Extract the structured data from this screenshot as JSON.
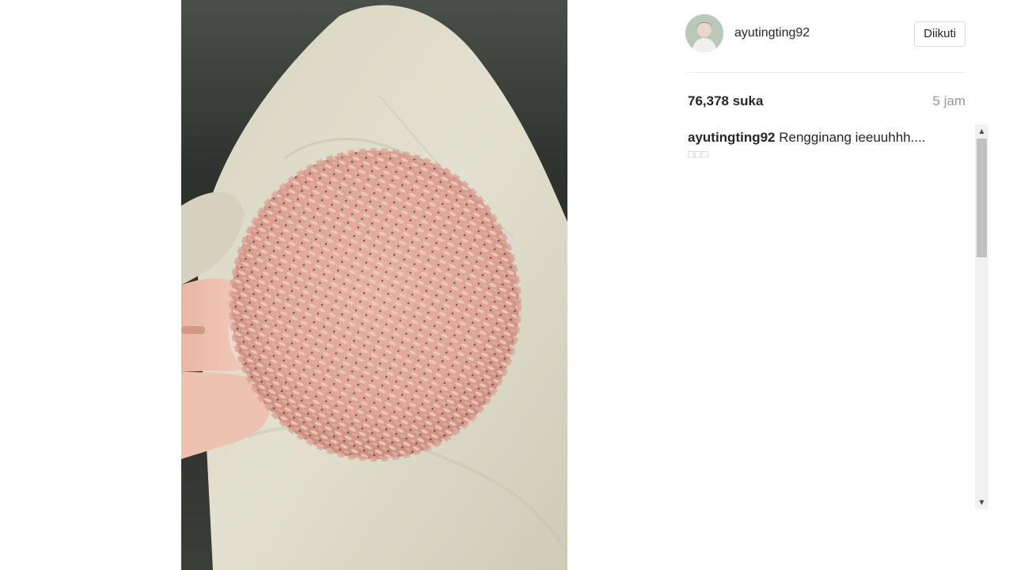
{
  "post": {
    "image_alt": "Hand holding a round pink rice cracker (rengginang) over a beige cloth",
    "likes": "76,378 suka",
    "time": "5 jam"
  },
  "author": {
    "username": "ayutingting92",
    "follow_label": "Diikuti"
  },
  "caption": {
    "username": "ayutingting92",
    "text": "Rengginang ieeuuhhh....",
    "emoji": "□□□"
  },
  "scrollbar": {
    "up_arrow": "▲",
    "down_arrow": "▼"
  },
  "colors": {
    "text": "#262626",
    "muted": "#999999",
    "border": "#dbdbdb"
  }
}
